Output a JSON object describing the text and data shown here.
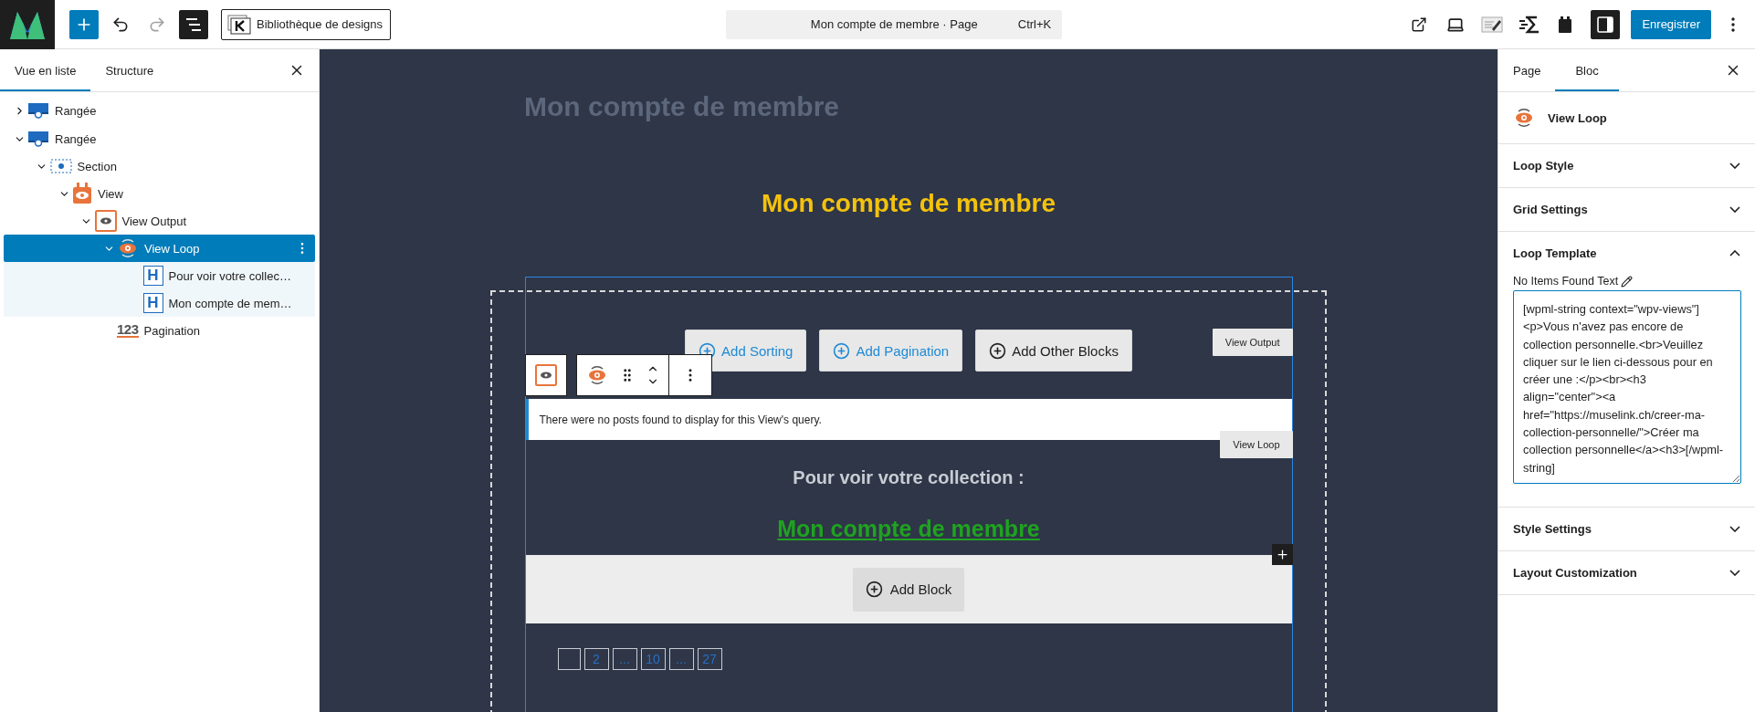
{
  "toolbar": {
    "design_library": "Bibliothèque de designs",
    "redo_disabled": true,
    "list_view_open": true,
    "command_bar": "Mon compte de membre · Page",
    "shortcut": "Ctrl+K",
    "settings_open": true,
    "save": "Enregistrer"
  },
  "list_view": {
    "tabs": [
      {
        "label": "Vue en liste",
        "selected": true
      },
      {
        "label": "Structure",
        "selected": false
      }
    ],
    "tree": [
      {
        "label": "Rangée",
        "kind": "row",
        "expanded": false,
        "selected": false
      },
      {
        "label": "Rangée",
        "kind": "row",
        "expanded": true,
        "selected": false,
        "children": [
          {
            "label": "Section",
            "kind": "section",
            "expanded": true,
            "selected": false,
            "children": [
              {
                "label": "View",
                "kind": "view",
                "expanded": true,
                "selected": false,
                "children": [
                  {
                    "label": "View Output",
                    "kind": "output",
                    "expanded": true,
                    "selected": false,
                    "children": [
                      {
                        "label": "View Loop",
                        "kind": "loop",
                        "expanded": true,
                        "selected": true,
                        "children": [
                          {
                            "label": "Pour voir votre collec…",
                            "kind": "heading",
                            "icon_text": "H",
                            "selected": false
                          },
                          {
                            "label": "Mon compte de mem…",
                            "kind": "heading",
                            "icon_text": "H",
                            "selected": false
                          }
                        ]
                      },
                      {
                        "label": "Pagination",
                        "kind": "pagination",
                        "icon_text": "123",
                        "selected": false
                      }
                    ]
                  }
                ]
              }
            ]
          }
        ]
      }
    ]
  },
  "canvas": {
    "page_title": "Mon compte de membre",
    "heading": "Mon compte de membre",
    "buttons": [
      {
        "label": "Add Sorting",
        "kind": "link"
      },
      {
        "label": "Add Pagination",
        "kind": "link"
      },
      {
        "label": "Add Other Blocks",
        "kind": "dark"
      }
    ],
    "view_output_tag": "View Output",
    "view_loop_tag": "View Loop",
    "notice": "There were no posts found to display for this View's query.",
    "loop_heading": "Pour voir votre collection :",
    "loop_link": "Mon compte de membre",
    "add_block": "Add Block",
    "pagination": [
      {
        "kind": "blank"
      },
      {
        "kind": "page",
        "label": "2"
      },
      {
        "kind": "page",
        "label": "..."
      },
      {
        "kind": "page",
        "label": "10"
      },
      {
        "kind": "page",
        "label": "..."
      },
      {
        "kind": "page",
        "label": "27"
      }
    ]
  },
  "settings": {
    "tabs": [
      {
        "label": "Page",
        "selected": false
      },
      {
        "label": "Bloc",
        "selected": true
      }
    ],
    "block_title": "View Loop",
    "sections": [
      {
        "title": "Loop Style",
        "expanded": false
      },
      {
        "title": "Grid Settings",
        "expanded": false
      },
      {
        "title": "Loop Template",
        "expanded": true,
        "field_label": "No Items Found Text",
        "field_value": "[wpml-string context=\"wpv-views\"]<p>Vous n'avez pas encore de collection personnelle.<br>Veuillez cliquer sur le lien ci-dessous pour en créer une :</p><br><h3 align=\"center\"><a href=\"https://muselink.ch/creer-ma-collection-personnelle/\">Créer ma collection personnelle</a><h3>[/wpml-string]"
      },
      {
        "title": "Style Settings",
        "expanded": false
      },
      {
        "title": "Layout Customization",
        "expanded": false
      }
    ]
  }
}
